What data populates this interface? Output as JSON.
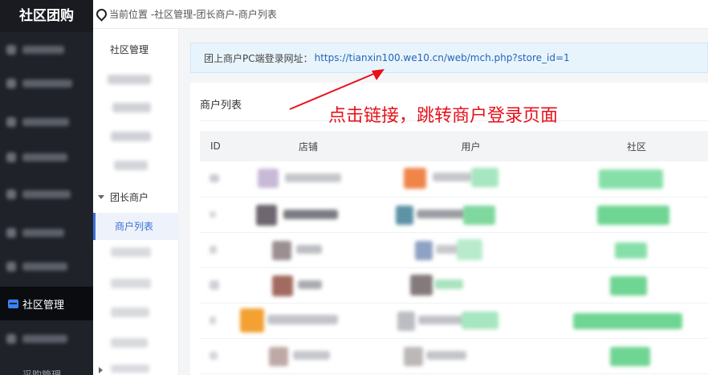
{
  "brand": {
    "title": "社区团购"
  },
  "left_nav": {
    "active_label": "社区管理",
    "bottom_partial_label": "采购管理"
  },
  "breadcrumb": {
    "prefix": "当前位置 - ",
    "path": [
      "社区管理",
      "团长商户",
      "商户列表"
    ],
    "separator": " - "
  },
  "sub_nav": {
    "title": "社区管理",
    "group_label": "团长商户",
    "active_item": "商户列表"
  },
  "notice": {
    "label": "团上商户PC端登录网址：",
    "url": "https://tianxin100.we10.cn/web/mch.php?store_id=1"
  },
  "merchant_list": {
    "title": "商户列表",
    "annotation": "点击链接，跳转商户登录页面",
    "columns": [
      "ID",
      "店铺",
      "用户",
      "社区"
    ]
  },
  "colors": {
    "sidebar_bg": "#1f2229",
    "accent_blue": "#3b6fd8",
    "annotation_red": "#e8101a",
    "notice_bg": "#e8f4fc"
  }
}
